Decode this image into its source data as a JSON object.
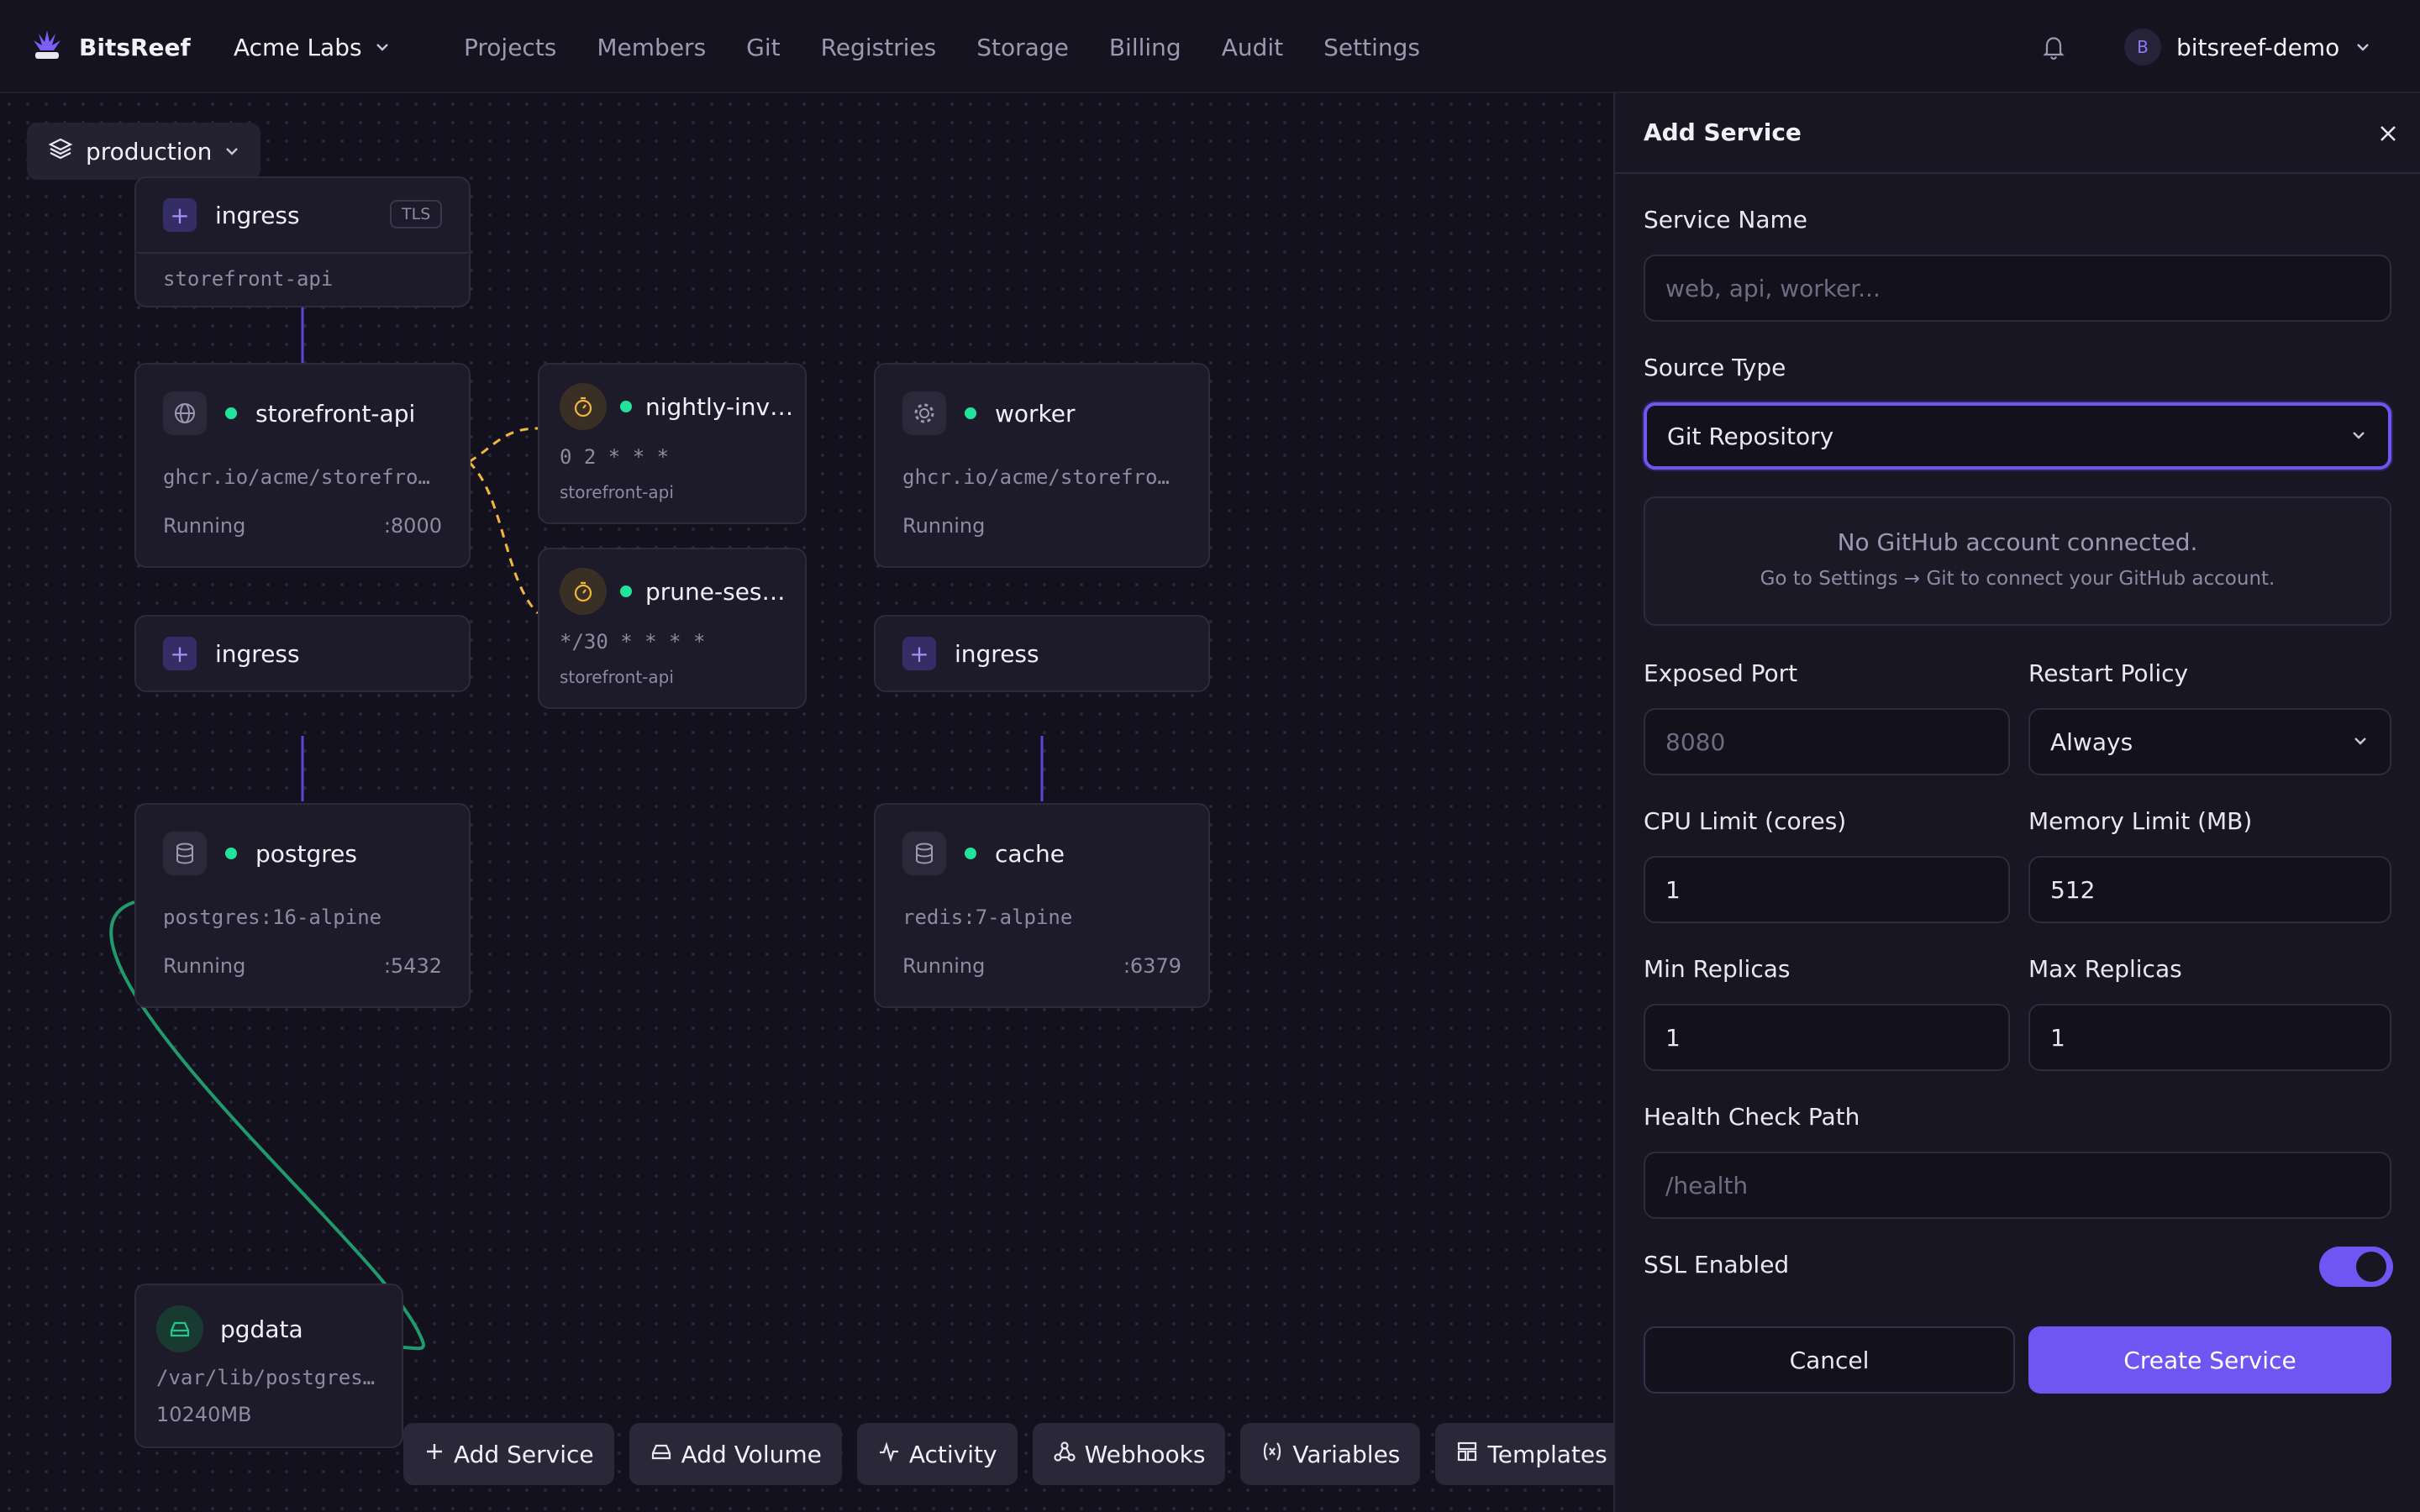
{
  "app": {
    "name": "BitsReef",
    "org": "Acme Labs"
  },
  "nav": [
    "Projects",
    "Members",
    "Git",
    "Registries",
    "Storage",
    "Billing",
    "Audit",
    "Settings"
  ],
  "user": {
    "initial": "B",
    "name": "bitsreef-demo"
  },
  "environment": "production",
  "canvas": {
    "ingress_top": {
      "label": "ingress",
      "badge": "TLS",
      "target": "storefront-api"
    },
    "storefront": {
      "name": "storefront-api",
      "image": "ghcr.io/acme/storefro…",
      "status": "Running",
      "port": ":8000"
    },
    "nightly": {
      "name": "nightly-inv…",
      "schedule": "0 2 * * *",
      "target": "storefront-api"
    },
    "prune": {
      "name": "prune-ses…",
      "schedule": "*/30 * * * *",
      "target": "storefront-api"
    },
    "worker": {
      "name": "worker",
      "image": "ghcr.io/acme/storefro…",
      "status": "Running"
    },
    "ingress_left": {
      "label": "ingress"
    },
    "ingress_right": {
      "label": "ingress"
    },
    "postgres": {
      "name": "postgres",
      "image": "postgres:16-alpine",
      "status": "Running",
      "port": ":5432"
    },
    "cache": {
      "name": "cache",
      "image": "redis:7-alpine",
      "status": "Running",
      "port": ":6379"
    },
    "pgdata": {
      "name": "pgdata",
      "path": "/var/lib/postgres…",
      "size": "10240MB"
    }
  },
  "dock": [
    "Add Service",
    "Add Volume",
    "Activity",
    "Webhooks",
    "Variables",
    "Templates"
  ],
  "panel": {
    "title": "Add Service",
    "service_name": {
      "label": "Service Name",
      "placeholder": "web, api, worker..."
    },
    "source_type": {
      "label": "Source Type",
      "value": "Git Repository"
    },
    "notice": {
      "title": "No GitHub account connected.",
      "body": "Go to Settings → Git to connect your GitHub account."
    },
    "exposed_port": {
      "label": "Exposed Port",
      "placeholder": "8080"
    },
    "restart_policy": {
      "label": "Restart Policy",
      "value": "Always"
    },
    "cpu_limit": {
      "label": "CPU Limit (cores)",
      "value": "1"
    },
    "memory_limit": {
      "label": "Memory Limit (MB)",
      "value": "512"
    },
    "min_replicas": {
      "label": "Min Replicas",
      "value": "1"
    },
    "max_replicas": {
      "label": "Max Replicas",
      "value": "1"
    },
    "health_check": {
      "label": "Health Check Path",
      "placeholder": "/health"
    },
    "ssl": {
      "label": "SSL Enabled",
      "enabled": true
    },
    "cancel": "Cancel",
    "create": "Create Service"
  },
  "colors": {
    "accent": "#6f55f2",
    "status_running": "#22e39b",
    "cron": "#f0b73a",
    "volume_link": "#1f9a6c",
    "link": "#5d45d6"
  }
}
